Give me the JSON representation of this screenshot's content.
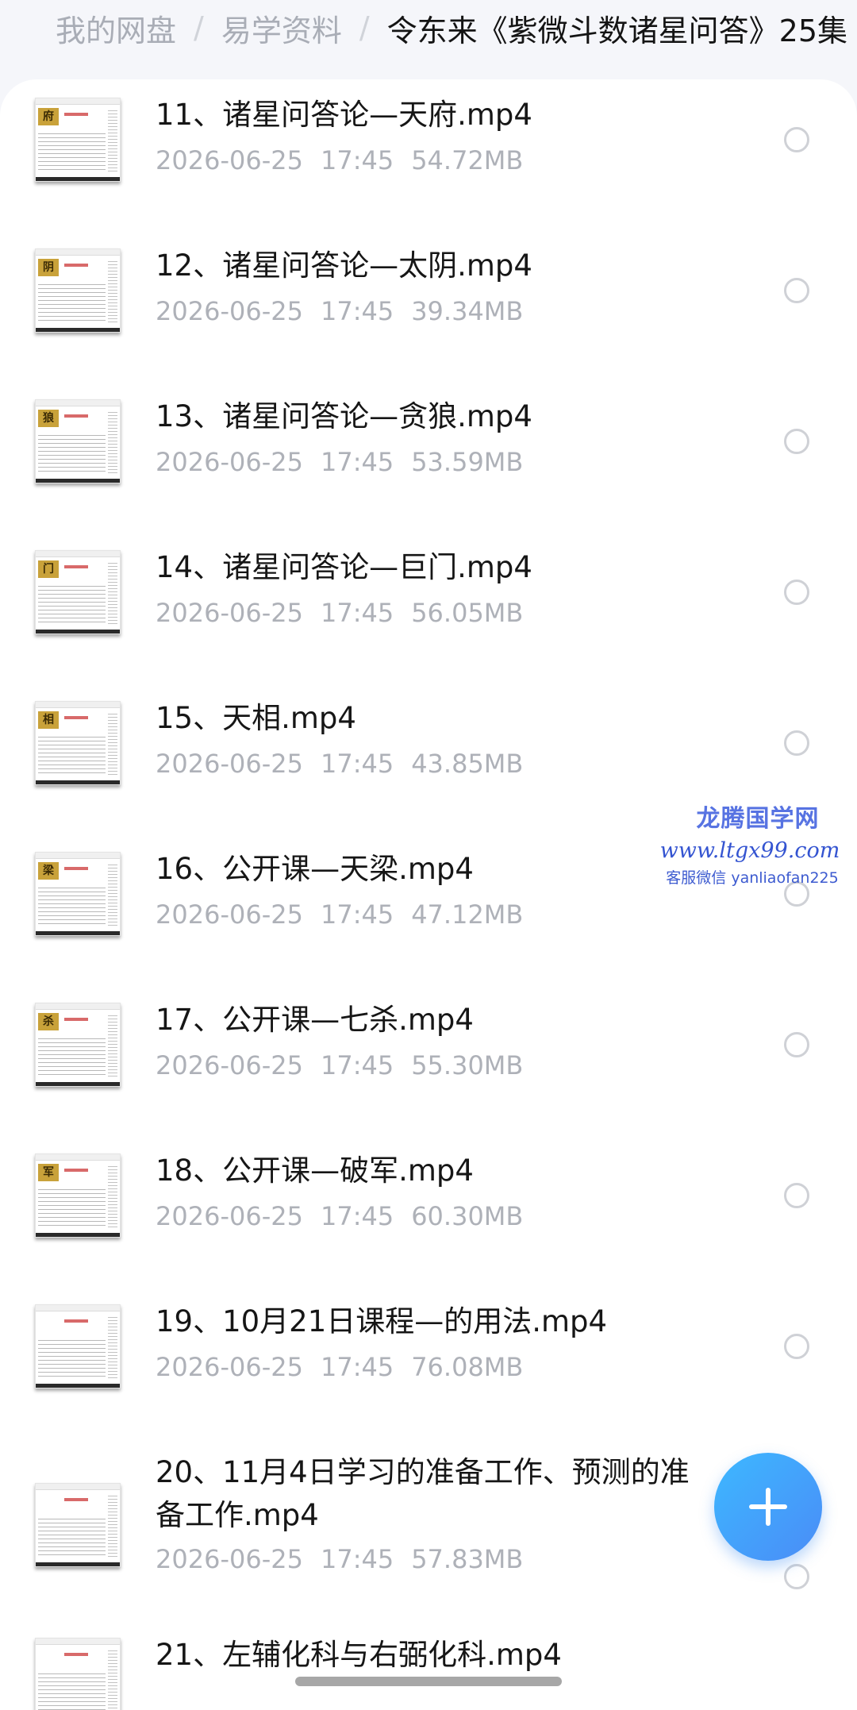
{
  "breadcrumb": {
    "root": "我的网盘",
    "parent": "易学资料",
    "current": "令东来《紫微斗数诸星问答》25集"
  },
  "files": [
    {
      "name": "11、诸星问答论—天府.mp4",
      "date": "2026-06-25",
      "time": "17:45",
      "size": "54.72MB",
      "thumb_seal": "府"
    },
    {
      "name": "12、诸星问答论—太阴.mp4",
      "date": "2026-06-25",
      "time": "17:45",
      "size": "39.34MB",
      "thumb_seal": "阴"
    },
    {
      "name": "13、诸星问答论—贪狼.mp4",
      "date": "2026-06-25",
      "time": "17:45",
      "size": "53.59MB",
      "thumb_seal": "狼"
    },
    {
      "name": "14、诸星问答论—巨门.mp4",
      "date": "2026-06-25",
      "time": "17:45",
      "size": "56.05MB",
      "thumb_seal": "门"
    },
    {
      "name": "15、天相.mp4",
      "date": "2026-06-25",
      "time": "17:45",
      "size": "43.85MB",
      "thumb_seal": "相"
    },
    {
      "name": "16、公开课—天梁.mp4",
      "date": "2026-06-25",
      "time": "17:45",
      "size": "47.12MB",
      "thumb_seal": "梁"
    },
    {
      "name": "17、公开课—七杀.mp4",
      "date": "2026-06-25",
      "time": "17:45",
      "size": "55.30MB",
      "thumb_seal": "杀"
    },
    {
      "name": "18、公开课—破军.mp4",
      "date": "2026-06-25",
      "time": "17:45",
      "size": "60.30MB",
      "thumb_seal": "军"
    },
    {
      "name": "19、10月21日课程—的用法.mp4",
      "date": "2026-06-25",
      "time": "17:45",
      "size": "76.08MB",
      "thumb_seal": ""
    },
    {
      "name": "20、11月4日学习的准备工作、预测的准备工作.mp4",
      "date": "2026-06-25",
      "time": "17:45",
      "size": "57.83MB",
      "thumb_seal": ""
    },
    {
      "name": "21、左辅化科与右弼化科.mp4",
      "date": "",
      "time": "",
      "size": "",
      "thumb_seal": ""
    }
  ],
  "watermark": {
    "title": "龙腾国学网",
    "url": "www.ltgx99.com",
    "contact": "客服微信 yanliaofan225"
  },
  "fab": {
    "icon": "plus-icon"
  },
  "colors": {
    "accent": "#4a8cf7",
    "watermark": "#3454d1",
    "meta_text": "#aeb1b8"
  }
}
